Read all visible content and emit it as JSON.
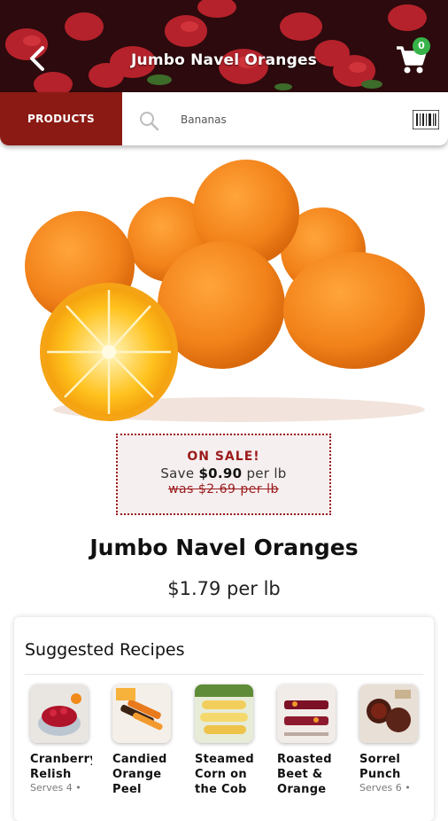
{
  "header": {
    "title": "Jumbo Navel Oranges",
    "cart_count": "0"
  },
  "search": {
    "products_label": "PRODUCTS",
    "value": "Bananas"
  },
  "product": {
    "name": "Jumbo Navel Oranges",
    "price": "$1.79 per lb",
    "sale": {
      "title": "ON SALE!",
      "save_prefix": "Save ",
      "save_amount": "$0.90",
      "save_suffix": " per lb",
      "was": "was $2.69 per lb"
    }
  },
  "recipes": {
    "title": "Suggested Recipes",
    "items": [
      {
        "name": "Cranberry Relish",
        "serves": "Serves 4 •"
      },
      {
        "name": "Candied Orange Peel",
        "serves": ""
      },
      {
        "name": "Steamed Corn on the Cob",
        "serves": ""
      },
      {
        "name": "Roasted Beet & Orange",
        "serves": ""
      },
      {
        "name": "Sorrel Punch",
        "serves": "Serves 6 •"
      }
    ]
  },
  "colors": {
    "brand_red": "#8b1a14",
    "badge_green": "#37b34a",
    "sale_red": "#9b1b1b"
  },
  "icons": [
    "back-icon",
    "cart-icon",
    "search-icon",
    "barcode-icon"
  ]
}
